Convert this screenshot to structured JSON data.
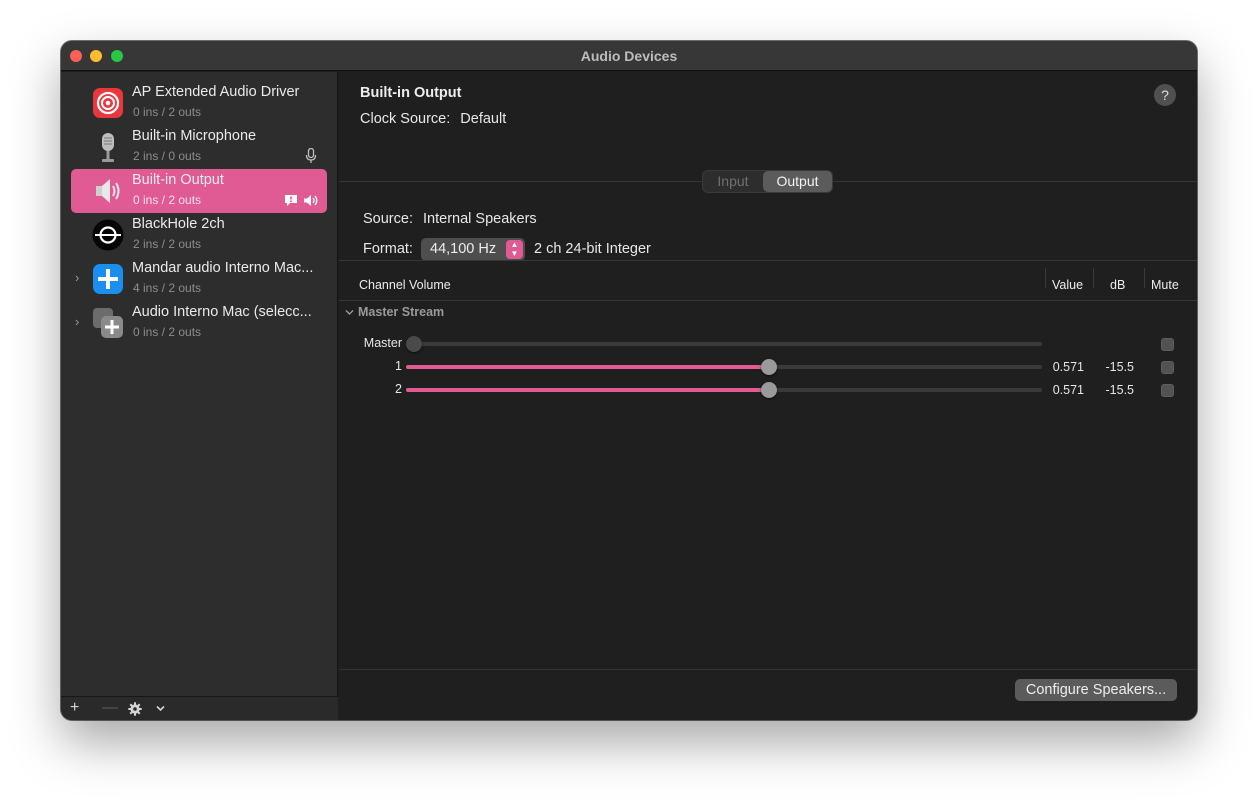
{
  "window": {
    "title": "Audio Devices"
  },
  "sidebar": {
    "devices": [
      {
        "name": "AP Extended Audio Driver",
        "io": "0 ins / 2 outs",
        "icon": "ap-target-icon"
      },
      {
        "name": "Built-in Microphone",
        "io": "2 ins / 0 outs",
        "icon": "microphone-icon",
        "badge": "mic-input-icon"
      },
      {
        "name": "Built-in Output",
        "io": "0 ins / 2 outs",
        "icon": "speaker-icon",
        "selected": true,
        "badges": [
          "system-alert-icon",
          "default-output-icon"
        ]
      },
      {
        "name": "BlackHole 2ch",
        "io": "2 ins / 2 outs",
        "icon": "blackhole-icon"
      },
      {
        "name": "Mandar audio Interno Mac...",
        "io": "4 ins / 2 outs",
        "icon": "multi-output-icon",
        "expandable": true
      },
      {
        "name": "Audio Interno Mac (selecc...",
        "io": "0 ins / 2 outs",
        "icon": "aggregate-device-icon",
        "expandable": true
      }
    ],
    "footer": {
      "add": "+",
      "remove": "—",
      "settings_icon": "gear-icon",
      "menu_icon": "chevron-down-icon"
    }
  },
  "detail": {
    "device_name": "Built-in Output",
    "clock_source_label": "Clock Source:",
    "clock_source_value": "Default",
    "help": "?",
    "tabs": {
      "input": "Input",
      "output": "Output",
      "selected": "output"
    },
    "source_label": "Source:",
    "source_value": "Internal Speakers",
    "format_label": "Format:",
    "format_value": "44,100 Hz",
    "format_desc": "2 ch 24-bit Integer"
  },
  "table": {
    "headers": {
      "channel": "Channel Volume",
      "value": "Value",
      "db": "dB",
      "mute": "Mute"
    },
    "group": "Master Stream",
    "rows": [
      {
        "label": "Master",
        "value": "",
        "db": "",
        "level": 0,
        "enabled": false
      },
      {
        "label": "1",
        "value": "0.571",
        "db": "-15.5",
        "level": 0.571,
        "enabled": true
      },
      {
        "label": "2",
        "value": "0.571",
        "db": "-15.5",
        "level": 0.571,
        "enabled": true
      }
    ]
  },
  "footer": {
    "configure_button": "Configure Speakers..."
  },
  "colors": {
    "accent": "#e05a94",
    "window_bg": "#1e1e1e",
    "sidebar_bg": "#2d2d2d"
  }
}
